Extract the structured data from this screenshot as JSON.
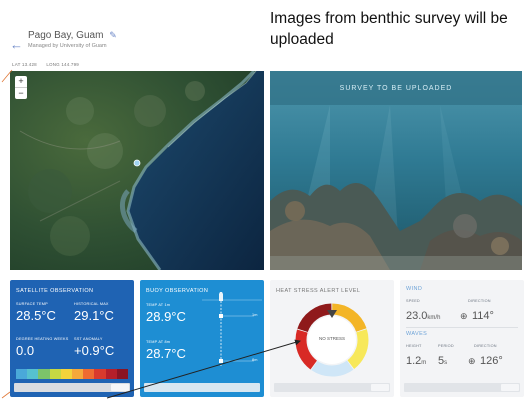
{
  "annotation": {
    "text": "Images from benthic survey will be uploaded"
  },
  "header": {
    "back_icon": "arrow-left-icon",
    "site_name": "Pago Bay, Guam",
    "edit_icon": "edit-icon",
    "managed_by": "Managed by University of Guam",
    "coordinates": [
      "LAT 13.428",
      "LONG 144.799"
    ]
  },
  "map": {
    "zoom_in": "+",
    "zoom_out": "−"
  },
  "survey": {
    "label": "SURVEY TO BE UPLOADED"
  },
  "satellite": {
    "title": "SATELLITE OBSERVATION",
    "surface_temp_label": "SURFACE TEMP",
    "surface_temp": "28.5°C",
    "historical_max_label": "HISTORICAL MAX",
    "historical_max": "29.1°C",
    "dhw_label": "DEGREE HEATING WEEKS",
    "dhw": "0.0",
    "sst_anomaly_label": "SST ANOMALY",
    "sst_anomaly": "+0.9°C",
    "colorscale": [
      "#4aa9d9",
      "#56c1cf",
      "#7cc36a",
      "#c6d843",
      "#f2d33b",
      "#f5a83a",
      "#ee6b31",
      "#d93a2d",
      "#b51f2a",
      "#8a1424"
    ]
  },
  "buoy": {
    "title": "BUOY OBSERVATION",
    "temp1_label": "TEMP AT 1m",
    "temp1": "28.9°C",
    "temp2_label": "TEMP AT 8m",
    "temp2": "28.7°C",
    "depth_top": "1m",
    "depth_bottom": "8m"
  },
  "heat_stress": {
    "title": "HEAT STRESS ALERT LEVEL",
    "level": "NO STRESS",
    "colors": [
      "#f3b527",
      "#f7e85a",
      "#cfe6f7",
      "#d82a25",
      "#8f1a1b"
    ]
  },
  "wind": {
    "title": "WIND",
    "speed_label": "SPEED",
    "speed": "23.0",
    "speed_unit": "km/h",
    "direction_label": "DIRECTION",
    "direction": "114°"
  },
  "waves": {
    "title": "WAVES",
    "height_label": "HEIGHT",
    "height": "1.2",
    "height_unit": "m",
    "period_label": "PERIOD",
    "period": "5",
    "period_unit": "s",
    "direction_label": "DIRECTION",
    "direction": "126°"
  }
}
